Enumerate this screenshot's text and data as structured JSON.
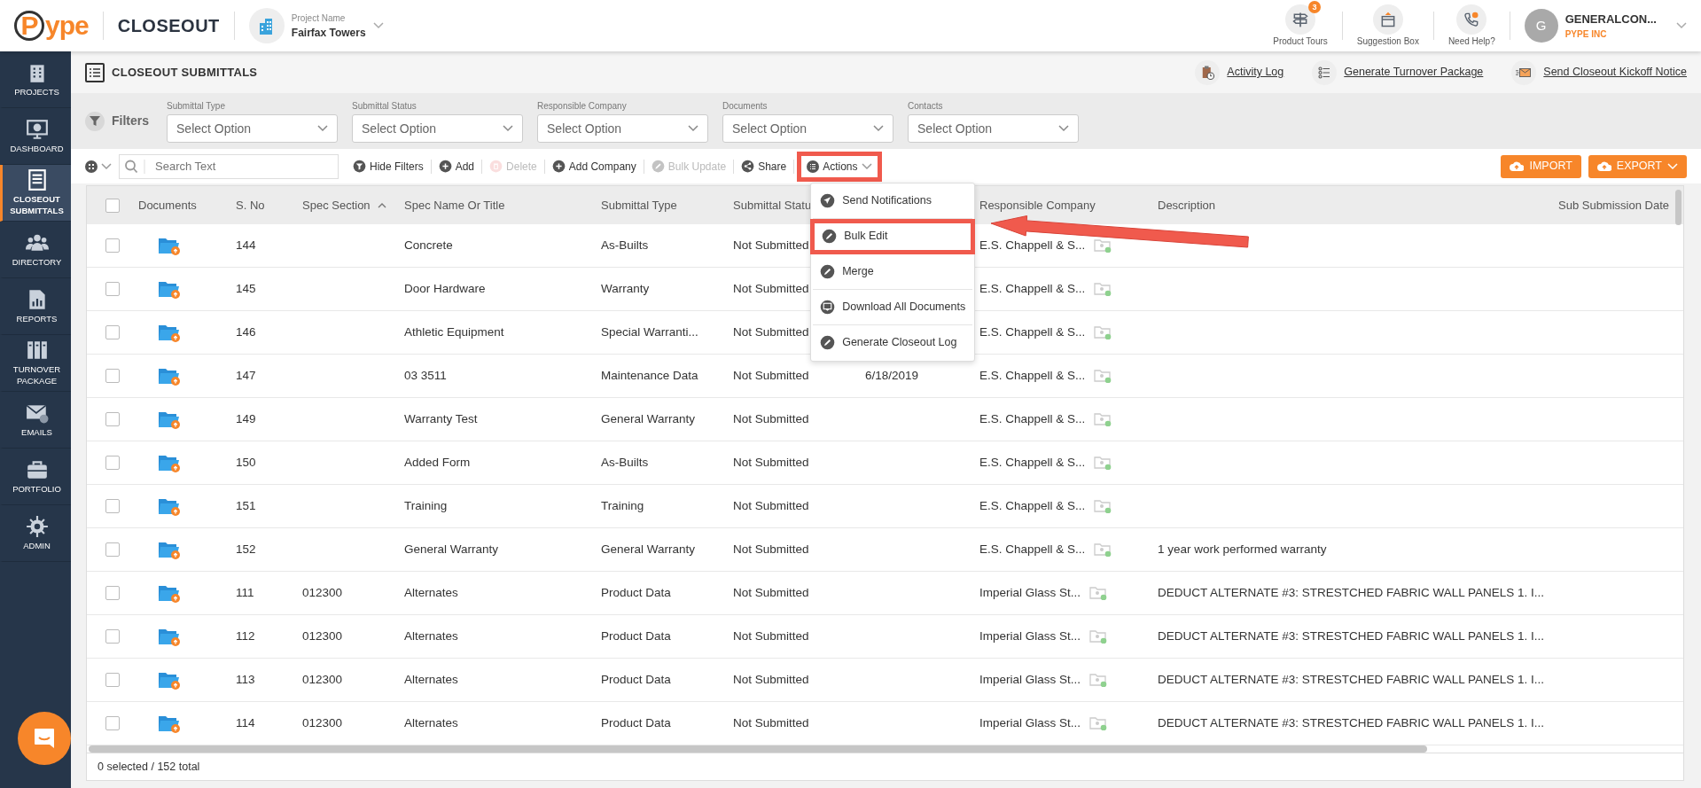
{
  "app": {
    "logo": "Pype",
    "module": "CLOSEOUT",
    "project_label": "Project Name",
    "project_name": "Fairfax Towers"
  },
  "top_actions": [
    {
      "label": "Product Tours",
      "badge": "3"
    },
    {
      "label": "Suggestion Box"
    },
    {
      "label": "Need Help?"
    }
  ],
  "user": {
    "initial": "G",
    "name": "GENERALCON...",
    "company": "PYPE INC"
  },
  "sidebar": {
    "items": [
      {
        "label": "PROJECTS",
        "selected": false
      },
      {
        "label": "DASHBOARD",
        "selected": false
      },
      {
        "label": "CLOSEOUT SUBMITTALS",
        "selected": true
      },
      {
        "label": "DIRECTORY",
        "selected": false
      },
      {
        "label": "REPORTS",
        "selected": false
      },
      {
        "label": "TURNOVER PACKAGE",
        "selected": false
      },
      {
        "label": "EMAILS",
        "selected": false
      },
      {
        "label": "PORTFOLIO",
        "selected": false
      },
      {
        "label": "ADMIN",
        "selected": false
      }
    ]
  },
  "page": {
    "title": "CLOSEOUT SUBMITTALS",
    "links": [
      {
        "label": "Activity Log"
      },
      {
        "label": "Generate Turnover Package"
      },
      {
        "label": "Send Closeout Kickoff Notice"
      }
    ]
  },
  "filters": {
    "label": "Filters",
    "fields": [
      {
        "label": "Submittal Type",
        "placeholder": "Select Option"
      },
      {
        "label": "Submittal Status",
        "placeholder": "Select Option"
      },
      {
        "label": "Responsible Company",
        "placeholder": "Select Option"
      },
      {
        "label": "Documents",
        "placeholder": "Select Option"
      },
      {
        "label": "Contacts",
        "placeholder": "Select Option"
      }
    ]
  },
  "toolbar": {
    "search_placeholder": "Search Text",
    "actions": [
      {
        "label": "Hide Filters",
        "disabled": false
      },
      {
        "label": "Add",
        "disabled": false
      },
      {
        "label": "Delete",
        "disabled": true
      },
      {
        "label": "Add Company",
        "disabled": false
      },
      {
        "label": "Bulk Update",
        "disabled": true
      },
      {
        "label": "Share",
        "disabled": false
      }
    ],
    "menu": {
      "label": "Actions",
      "expanded": true,
      "highlighted": true,
      "items": [
        {
          "label": "Send Notifications",
          "highlighted": false
        },
        {
          "label": "Bulk Edit",
          "highlighted": true
        },
        {
          "label": "Merge",
          "highlighted": false
        },
        {
          "label": "Download All Documents",
          "highlighted": false
        },
        {
          "label": "Generate Closeout Log",
          "highlighted": false
        }
      ]
    },
    "buttons": [
      {
        "label": "IMPORT",
        "caret": false
      },
      {
        "label": "EXPORT",
        "caret": true
      }
    ]
  },
  "annotations": [
    {
      "kind": "arrow"
    }
  ],
  "table": {
    "all_checked": false,
    "columns": [
      {
        "label": "Documents",
        "sorted": false
      },
      {
        "label": "S. No",
        "sorted": false
      },
      {
        "label": "Spec Section",
        "sorted": true
      },
      {
        "label": "Spec Name Or Title",
        "sorted": false
      },
      {
        "label": "Submittal Type",
        "sorted": false
      },
      {
        "label": "Submittal Statu",
        "sorted": false
      },
      {
        "label": "Responsible Company",
        "sorted": false
      },
      {
        "label": "Description",
        "sorted": false
      },
      {
        "label": "Sub Submission Date",
        "sorted": false
      }
    ],
    "rows": [
      {
        "checked": false,
        "sno": "144",
        "title": "Concrete",
        "type": "As-Builts",
        "status": "Not Submitted",
        "company": "E.S. Chappell & S..."
      },
      {
        "checked": false,
        "sno": "145",
        "title": "Door Hardware",
        "type": "Warranty",
        "status": "Not Submitted",
        "company": "E.S. Chappell & S..."
      },
      {
        "checked": false,
        "sno": "146",
        "title": "Athletic Equipment",
        "type": "Special Warranti...",
        "status": "Not Submitted",
        "company": "E.S. Chappell & S..."
      },
      {
        "checked": false,
        "sno": "147",
        "title": "03 3511",
        "type": "Maintenance Data",
        "status": "Not Submitted",
        "column_7": "6/18/2019",
        "company": "E.S. Chappell & S..."
      },
      {
        "checked": false,
        "sno": "149",
        "title": "Warranty Test",
        "type": "General Warranty",
        "status": "Not Submitted",
        "company": "E.S. Chappell & S..."
      },
      {
        "checked": false,
        "sno": "150",
        "title": "Added Form",
        "type": "As-Builts",
        "status": "Not Submitted",
        "company": "E.S. Chappell & S..."
      },
      {
        "checked": false,
        "sno": "151",
        "title": "Training",
        "type": "Training",
        "status": "Not Submitted",
        "company": "E.S. Chappell & S..."
      },
      {
        "checked": false,
        "sno": "152",
        "title": "General Warranty",
        "type": "General Warranty",
        "status": "Not Submitted",
        "company": "E.S. Chappell & S...",
        "description": "1 year work performed warranty"
      },
      {
        "checked": false,
        "sno": "111",
        "spec_section": "012300",
        "title": "Alternates",
        "type": "Product Data",
        "status": "Not Submitted",
        "company": "Imperial Glass St...",
        "description": "DEDUCT ALTERNATE #3: STRESTCHED FABRIC WALL PANELS 1. I..."
      },
      {
        "checked": false,
        "sno": "112",
        "spec_section": "012300",
        "title": "Alternates",
        "type": "Product Data",
        "status": "Not Submitted",
        "company": "Imperial Glass St...",
        "description": "DEDUCT ALTERNATE #3: STRESTCHED FABRIC WALL PANELS 1. I..."
      },
      {
        "checked": false,
        "sno": "113",
        "spec_section": "012300",
        "title": "Alternates",
        "type": "Product Data",
        "status": "Not Submitted",
        "company": "Imperial Glass St...",
        "description": "DEDUCT ALTERNATE #3: STRESTCHED FABRIC WALL PANELS 1. I..."
      },
      {
        "checked": false,
        "sno": "114",
        "spec_section": "012300",
        "title": "Alternates",
        "type": "Product Data",
        "status": "Not Submitted",
        "company": "Imperial Glass St...",
        "description": "DEDUCT ALTERNATE #3: STRESTCHED FABRIC WALL PANELS 1. I..."
      }
    ]
  },
  "status_bar": "0 selected / 152 total"
}
